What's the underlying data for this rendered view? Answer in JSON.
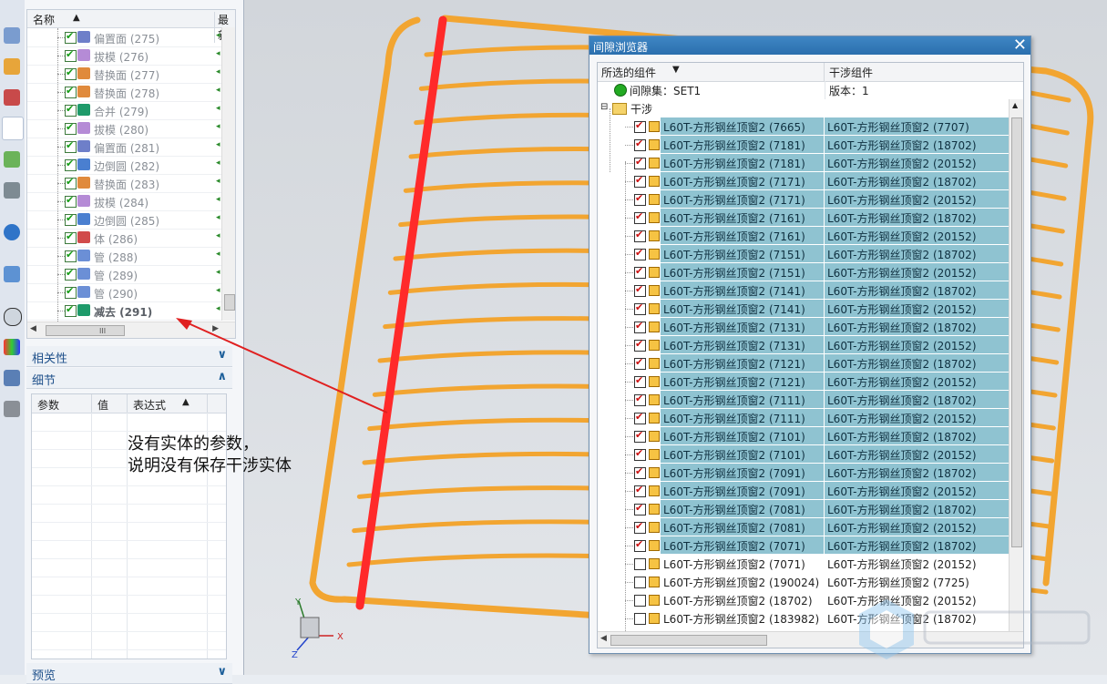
{
  "navigator": {
    "col_name": "名称",
    "col_latest": "最新",
    "tree_items": [
      {
        "label": "偏置面 (275)",
        "icon": "offset-face-icon",
        "color": "#6e7fc9"
      },
      {
        "label": "拔模 (276)",
        "icon": "draft-icon",
        "color": "#b58bd6"
      },
      {
        "label": "替换面 (277)",
        "icon": "replace-face-icon",
        "color": "#e08a3c"
      },
      {
        "label": "替换面 (278)",
        "icon": "replace-face-icon",
        "color": "#e08a3c"
      },
      {
        "label": "合并 (279)",
        "icon": "unite-icon",
        "color": "#1e9a6a"
      },
      {
        "label": "拔模 (280)",
        "icon": "draft-icon",
        "color": "#b58bd6"
      },
      {
        "label": "偏置面 (281)",
        "icon": "offset-face-icon",
        "color": "#6e7fc9"
      },
      {
        "label": "边倒圆 (282)",
        "icon": "edge-blend-icon",
        "color": "#4a7fd0"
      },
      {
        "label": "替换面 (283)",
        "icon": "replace-face-icon",
        "color": "#e08a3c"
      },
      {
        "label": "拔模 (284)",
        "icon": "draft-icon",
        "color": "#b58bd6"
      },
      {
        "label": "边倒圆 (285)",
        "icon": "edge-blend-icon",
        "color": "#4a7fd0"
      },
      {
        "label": "体 (286)",
        "icon": "body-icon",
        "color": "#d14b4b"
      },
      {
        "label": "管 (288)",
        "icon": "tube-icon",
        "color": "#6b8fd6"
      },
      {
        "label": "管 (289)",
        "icon": "tube-icon",
        "color": "#6b8fd6"
      },
      {
        "label": "管 (290)",
        "icon": "tube-icon",
        "color": "#6b8fd6"
      },
      {
        "label": "减去 (291)",
        "icon": "subtract-icon",
        "color": "#1e9a6a",
        "bold": true
      }
    ],
    "section_dependencies": "相关性",
    "section_details": "细节",
    "params_headers": [
      "参数",
      "值",
      "表达式"
    ],
    "section_preview": "预览"
  },
  "annotation": {
    "line1": "没有实体的参数，",
    "line2": "说明没有保存干涉实体"
  },
  "clearance_browser": {
    "title": "间隙浏览器",
    "col_selected": "所选的组件",
    "col_interfering": "干涉组件",
    "set_label": "间隙集：SET1",
    "version_label": "版本：1",
    "folder_label": "干涉",
    "rows": [
      {
        "a": "L60T-方形钢丝顶窗2 (7665)",
        "b": "L60T-方形钢丝顶窗2 (7707)",
        "checked": true,
        "selected": true
      },
      {
        "a": "L60T-方形钢丝顶窗2 (7181)",
        "b": "L60T-方形钢丝顶窗2 (18702)",
        "checked": true,
        "selected": true
      },
      {
        "a": "L60T-方形钢丝顶窗2 (7181)",
        "b": "L60T-方形钢丝顶窗2 (20152)",
        "checked": true,
        "selected": true
      },
      {
        "a": "L60T-方形钢丝顶窗2 (7171)",
        "b": "L60T-方形钢丝顶窗2 (18702)",
        "checked": true,
        "selected": true
      },
      {
        "a": "L60T-方形钢丝顶窗2 (7171)",
        "b": "L60T-方形钢丝顶窗2 (20152)",
        "checked": true,
        "selected": true
      },
      {
        "a": "L60T-方形钢丝顶窗2 (7161)",
        "b": "L60T-方形钢丝顶窗2 (18702)",
        "checked": true,
        "selected": true
      },
      {
        "a": "L60T-方形钢丝顶窗2 (7161)",
        "b": "L60T-方形钢丝顶窗2 (20152)",
        "checked": true,
        "selected": true
      },
      {
        "a": "L60T-方形钢丝顶窗2 (7151)",
        "b": "L60T-方形钢丝顶窗2 (18702)",
        "checked": true,
        "selected": true
      },
      {
        "a": "L60T-方形钢丝顶窗2 (7151)",
        "b": "L60T-方形钢丝顶窗2 (20152)",
        "checked": true,
        "selected": true
      },
      {
        "a": "L60T-方形钢丝顶窗2 (7141)",
        "b": "L60T-方形钢丝顶窗2 (18702)",
        "checked": true,
        "selected": true
      },
      {
        "a": "L60T-方形钢丝顶窗2 (7141)",
        "b": "L60T-方形钢丝顶窗2 (20152)",
        "checked": true,
        "selected": true
      },
      {
        "a": "L60T-方形钢丝顶窗2 (7131)",
        "b": "L60T-方形钢丝顶窗2 (18702)",
        "checked": true,
        "selected": true
      },
      {
        "a": "L60T-方形钢丝顶窗2 (7131)",
        "b": "L60T-方形钢丝顶窗2 (20152)",
        "checked": true,
        "selected": true
      },
      {
        "a": "L60T-方形钢丝顶窗2 (7121)",
        "b": "L60T-方形钢丝顶窗2 (18702)",
        "checked": true,
        "selected": true
      },
      {
        "a": "L60T-方形钢丝顶窗2 (7121)",
        "b": "L60T-方形钢丝顶窗2 (20152)",
        "checked": true,
        "selected": true
      },
      {
        "a": "L60T-方形钢丝顶窗2 (7111)",
        "b": "L60T-方形钢丝顶窗2 (18702)",
        "checked": true,
        "selected": true
      },
      {
        "a": "L60T-方形钢丝顶窗2 (7111)",
        "b": "L60T-方形钢丝顶窗2 (20152)",
        "checked": true,
        "selected": true
      },
      {
        "a": "L60T-方形钢丝顶窗2 (7101)",
        "b": "L60T-方形钢丝顶窗2 (18702)",
        "checked": true,
        "selected": true
      },
      {
        "a": "L60T-方形钢丝顶窗2 (7101)",
        "b": "L60T-方形钢丝顶窗2 (20152)",
        "checked": true,
        "selected": true
      },
      {
        "a": "L60T-方形钢丝顶窗2 (7091)",
        "b": "L60T-方形钢丝顶窗2 (18702)",
        "checked": true,
        "selected": true
      },
      {
        "a": "L60T-方形钢丝顶窗2 (7091)",
        "b": "L60T-方形钢丝顶窗2 (20152)",
        "checked": true,
        "selected": true
      },
      {
        "a": "L60T-方形钢丝顶窗2 (7081)",
        "b": "L60T-方形钢丝顶窗2 (18702)",
        "checked": true,
        "selected": true
      },
      {
        "a": "L60T-方形钢丝顶窗2 (7081)",
        "b": "L60T-方形钢丝顶窗2 (20152)",
        "checked": true,
        "selected": true
      },
      {
        "a": "L60T-方形钢丝顶窗2 (7071)",
        "b": "L60T-方形钢丝顶窗2 (18702)",
        "checked": true,
        "selected": true
      },
      {
        "a": "L60T-方形钢丝顶窗2 (7071)",
        "b": "L60T-方形钢丝顶窗2 (20152)",
        "checked": false,
        "selected": false
      },
      {
        "a": "L60T-方形钢丝顶窗2 (190024)",
        "b": "L60T-方形钢丝顶窗2 (7725)",
        "checked": false,
        "selected": false
      },
      {
        "a": "L60T-方形钢丝顶窗2 (18702)",
        "b": "L60T-方形钢丝顶窗2 (20152)",
        "checked": false,
        "selected": false
      },
      {
        "a": "L60T-方形钢丝顶窗2 (183982)",
        "b": "L60T-方形钢丝顶窗2 (18702)",
        "checked": false,
        "selected": false
      }
    ]
  },
  "triad": {
    "x": "X",
    "y": "Y",
    "z": "Z"
  },
  "colors": {
    "selection": "#8fc3d1",
    "frame": "#f2a531",
    "highlight": "#ff2a2a",
    "title_bar": "#2b6fae"
  }
}
